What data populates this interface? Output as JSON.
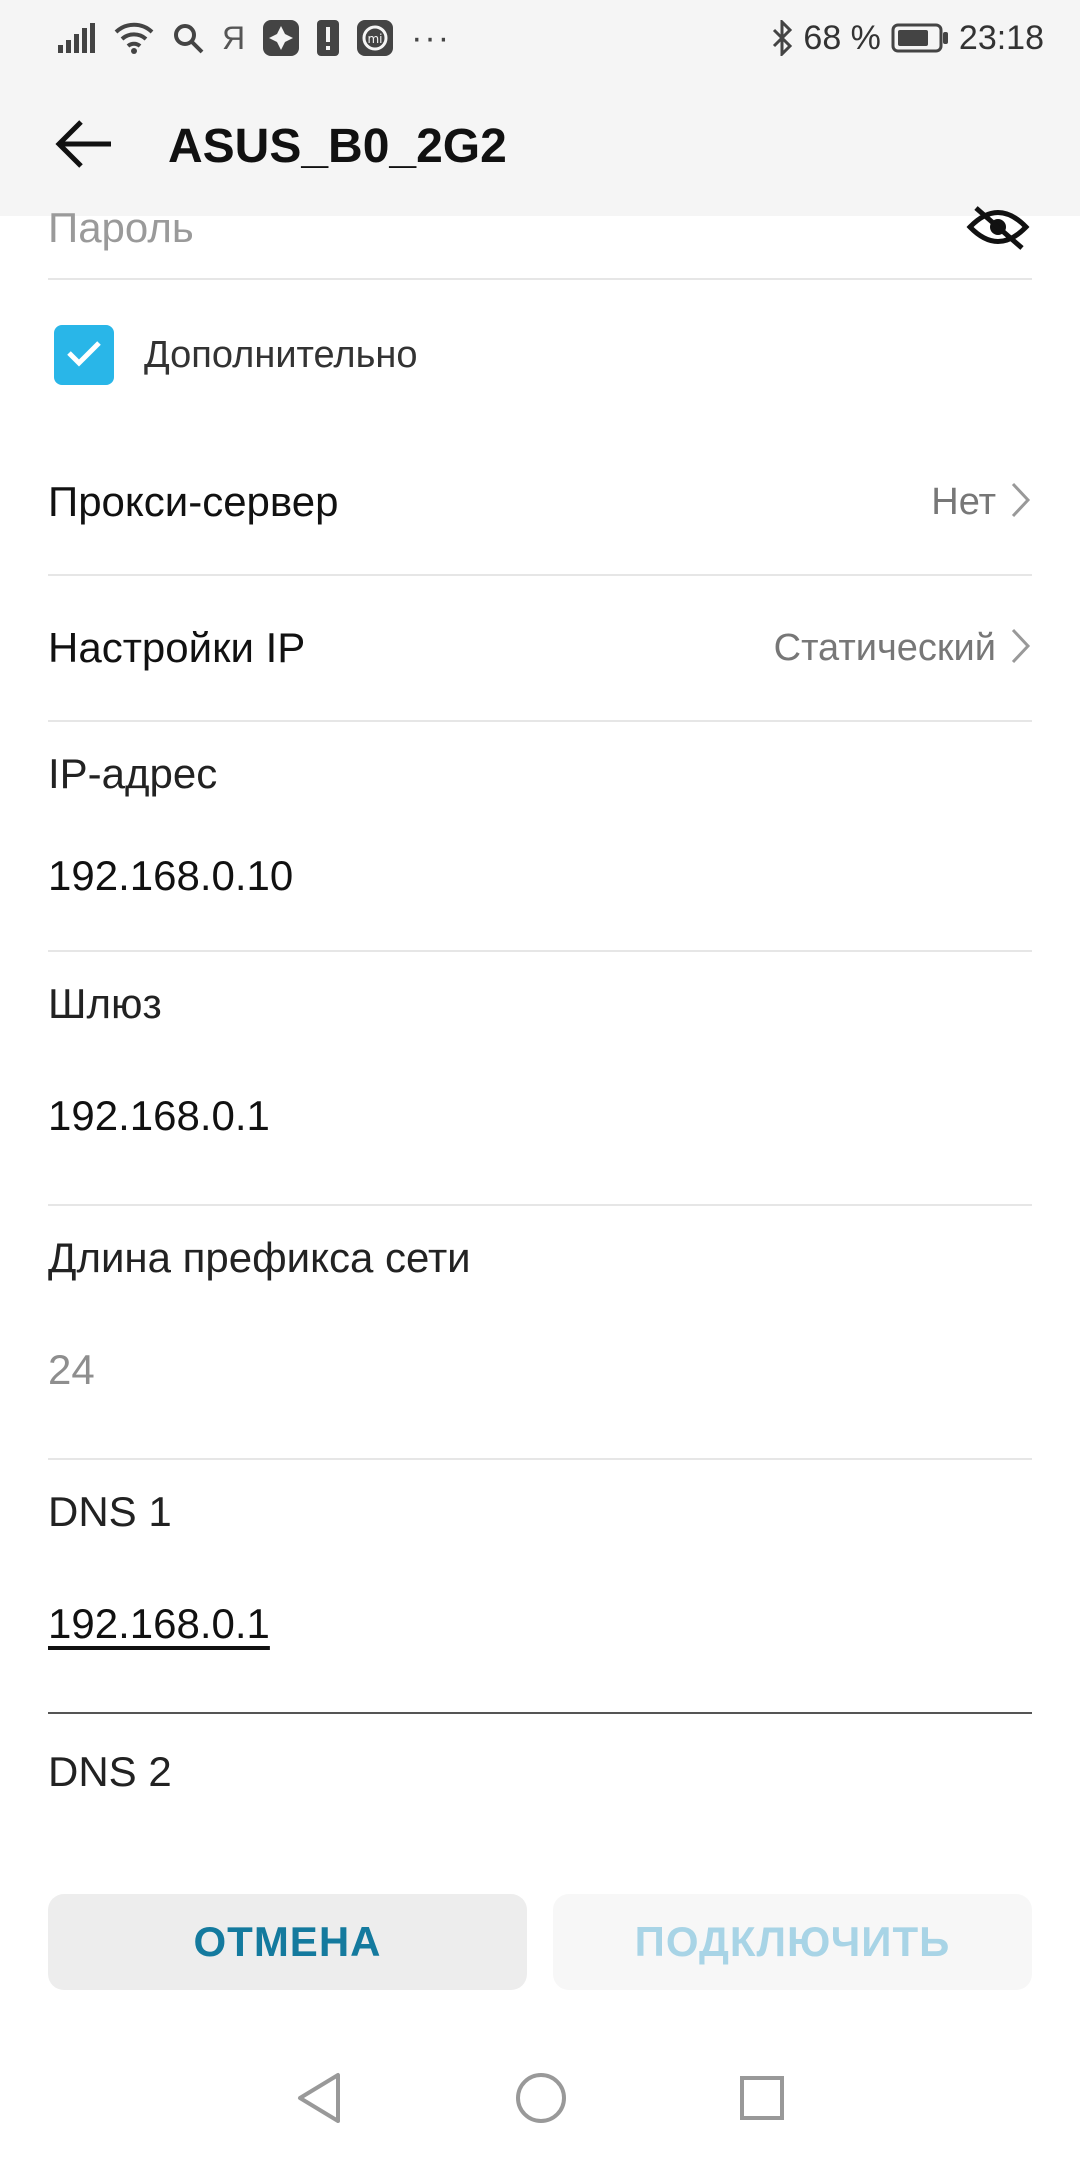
{
  "status_bar": {
    "carrier_letter": "Я",
    "more_dots": "···",
    "battery_percent": "68 %",
    "time": "23:18",
    "icons": [
      "signal-icon",
      "wifi-icon",
      "search-icon",
      "yandex-icon",
      "app-icon",
      "alert-icon",
      "mi-icon",
      "more-icon",
      "bluetooth-icon",
      "battery-icon"
    ]
  },
  "app_bar": {
    "title": "ASUS_B0_2G2",
    "back_icon": "arrow-left-icon"
  },
  "password": {
    "placeholder": "Пароль",
    "toggle_icon": "eye-off-icon"
  },
  "advanced": {
    "label": "Дополнительно",
    "checked": true,
    "accent": "#29b6e8"
  },
  "proxy": {
    "label": "Прокси-сервер",
    "value": "Нет"
  },
  "ip_settings": {
    "label": "Настройки IP",
    "value": "Статический"
  },
  "fields": {
    "ip": {
      "label": "IP-адрес",
      "value": "192.168.0.10"
    },
    "gateway": {
      "label": "Шлюз",
      "value": "192.168.0.1"
    },
    "prefix": {
      "label": "Длина префикса сети",
      "value": "24"
    },
    "dns1": {
      "label": "DNS 1",
      "value": "192.168.0.1"
    },
    "dns2": {
      "label": "DNS 2"
    }
  },
  "actions": {
    "cancel": "ОТМЕНА",
    "connect": "ПОДКЛЮЧИТЬ",
    "cancel_color": "#147a9e",
    "connect_color": "#a8d4e6"
  },
  "nav_bar": {
    "icons": [
      "back-triangle-icon",
      "home-circle-icon",
      "recents-square-icon"
    ]
  }
}
